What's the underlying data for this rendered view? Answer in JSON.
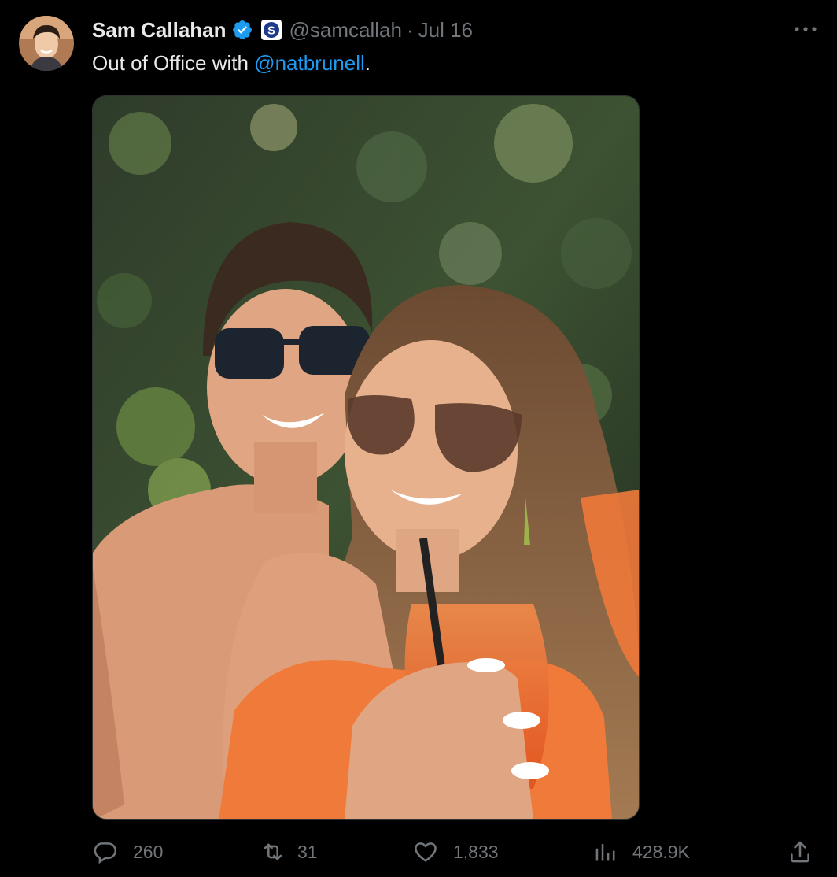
{
  "author": {
    "display_name": "Sam Callahan",
    "handle": "@samcallah",
    "separator": "·",
    "date": "Jul 16",
    "verified": true,
    "affiliate_badge_icon": "circle-s-icon"
  },
  "tweet": {
    "text_prefix": "Out of Office with ",
    "mention": "@natbrunell",
    "text_suffix": "."
  },
  "media": {
    "alt_icon": "photo"
  },
  "actions": {
    "reply_count": "260",
    "retweet_count": "31",
    "like_count": "1,833",
    "views_count": "428.9K"
  },
  "colors": {
    "background": "#000000",
    "text_primary": "#e7e9ea",
    "text_secondary": "#71767b",
    "accent": "#1d9bf0"
  }
}
